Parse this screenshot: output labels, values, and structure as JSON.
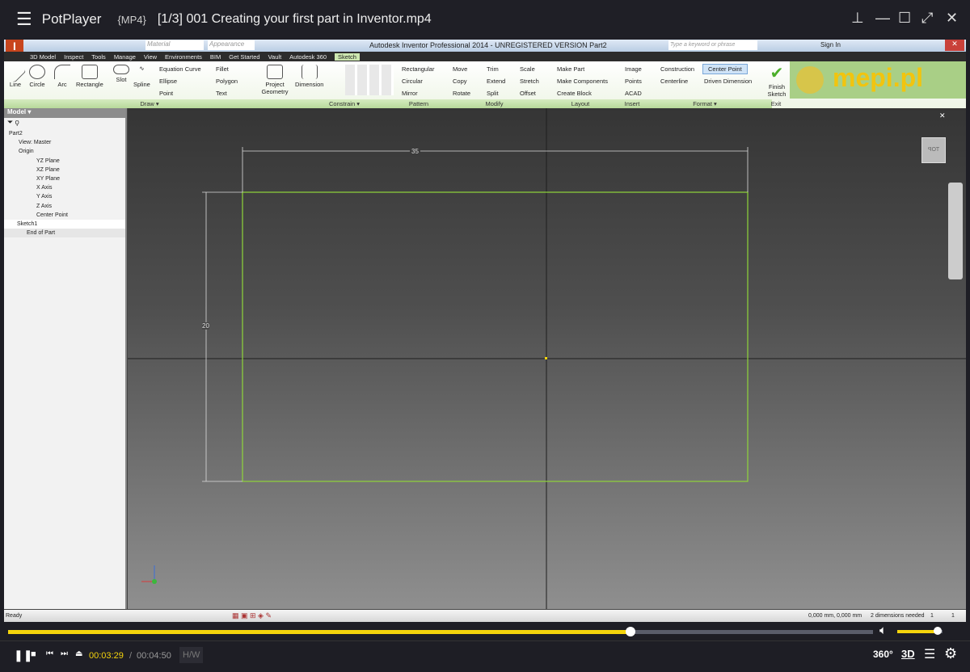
{
  "player": {
    "app_name": "PotPlayer",
    "format": "{MP4}",
    "file_title": "[1/3] 001 Creating your first part in Inventor.mp4",
    "elapsed": "00:03:29",
    "separator": "/",
    "duration": "00:04:50",
    "hw_label": "H/W",
    "progress_fraction": 0.72,
    "volume_fraction": 0.9,
    "right_buttons": [
      "360°",
      "3D"
    ]
  },
  "inventor": {
    "title": "Autodesk Inventor Professional 2014 - UNREGISTERED VERSION    Part2",
    "material": "Material",
    "appearance": "Appearance",
    "search_placeholder": "Type a keyword or phrase",
    "sign_in": "Sign In",
    "tabs": [
      "3D Model",
      "Inspect",
      "Tools",
      "Manage",
      "View",
      "Environments",
      "BIM",
      "Get Started",
      "Vault",
      "Autodesk 360",
      "Sketch"
    ],
    "active_tab": "Sketch",
    "draw_big": [
      "Line",
      "Circle",
      "Arc",
      "Rectangle",
      "Slot",
      "Spline"
    ],
    "draw_small": [
      "Equation Curve",
      "Ellipse",
      "Point",
      "Fillet",
      "Polygon",
      "Text"
    ],
    "project_geometry": "Project Geometry",
    "dimension": "Dimension",
    "pattern": [
      "Rectangular",
      "Circular",
      "Mirror"
    ],
    "modify": [
      "Move",
      "Copy",
      "Rotate",
      "Trim",
      "Extend",
      "Split",
      "Scale",
      "Stretch",
      "Offset"
    ],
    "layout": [
      "Make Part",
      "Make Components",
      "Create Block"
    ],
    "insert": [
      "Image",
      "Points",
      "ACAD"
    ],
    "format": [
      "Construction",
      "Centerline",
      "Center Point",
      "Driven Dimension"
    ],
    "finish_sketch": "Finish Sketch",
    "panels": [
      "Draw ▾",
      "Constrain ▾",
      "Pattern",
      "Modify",
      "Layout",
      "Insert",
      "Format ▾",
      "Exit"
    ],
    "logo": "mepi.pl",
    "browser": {
      "header": "Model ▾",
      "items": [
        "Part2",
        "View: Master",
        "Origin",
        "YZ Plane",
        "XZ Plane",
        "XY Plane",
        "X Axis",
        "Y Axis",
        "Z Axis",
        "Center Point",
        "Sketch1",
        "End of Part"
      ]
    },
    "view_cube": "TOP",
    "dimensions": {
      "width": "35",
      "height": "20"
    },
    "status": {
      "left": "Ready",
      "coords": "0,000 mm, 0,000 mm",
      "needed": "2 dimensions needed",
      "n1": "1",
      "n2": "1"
    },
    "colors": {
      "sketch": "#8fd63a",
      "accent": "#f5d40c"
    }
  }
}
